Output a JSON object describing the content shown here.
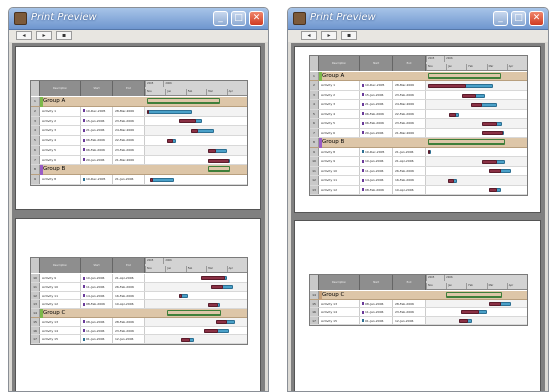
{
  "windows": [
    {
      "title": "Print Preview",
      "toolbar": [
        "◂",
        "▸",
        "▪"
      ],
      "controls": [
        "_",
        "□",
        "✕"
      ],
      "pages": [
        {
          "headers": [
            "Description",
            "Start",
            "End"
          ],
          "tl_top": [
            "2005",
            "2006"
          ],
          "tl_bottom": [
            "Nov",
            "Jan",
            "Feb",
            "Mar",
            "Apr"
          ],
          "rows": [
            {
              "type": "group",
              "num": "1",
              "name": "Group A",
              "color": "#7cb84a",
              "group_bar": [
                0.02,
                0.74
              ]
            },
            {
              "type": "task",
              "num": "2",
              "name": "Activity 1",
              "start": "10-Dec-2005",
              "end": "28-Mar-2006",
              "mark": "#6a3a9a",
              "plan": [
                0.02,
                0.46
              ],
              "actual": [
                0.02,
                0.03
              ]
            },
            {
              "type": "task",
              "num": "3",
              "name": "Activity 2",
              "start": "15-Jan-2006",
              "end": "23-Feb-2006",
              "mark": "#6a3a9a",
              "plan": [
                0.33,
                0.56
              ],
              "actual": [
                0.33,
                0.5
              ]
            },
            {
              "type": "task",
              "num": "4",
              "name": "Activity 3",
              "start": "21-Jan-2006",
              "end": "24-Mar-2006",
              "mark": "#6a3a9a",
              "plan": [
                0.45,
                0.68
              ],
              "actual": [
                0.45,
                0.52
              ]
            },
            {
              "type": "task",
              "num": "5",
              "name": "Activity 4",
              "start": "06-Feb-2006",
              "end": "22-Feb-2006",
              "mark": "#6a3a9a",
              "plan": [
                0.22,
                0.3
              ],
              "actual": [
                0.22,
                0.27
              ]
            },
            {
              "type": "task",
              "num": "6",
              "name": "Activity 5",
              "start": "06-Feb-2006",
              "end": "23-Feb-2006",
              "mark": "#6a3a9a",
              "plan": [
                0.62,
                0.8
              ],
              "actual": [
                0.62,
                0.7
              ]
            },
            {
              "type": "task",
              "num": "7",
              "name": "Activity 6",
              "start": "20-Jan-2006",
              "end": "21-Mar-2006",
              "mark": "#6a3a9a",
              "plan": [
                0.62,
                0.83
              ],
              "actual": [
                0.62,
                0.82
              ]
            },
            {
              "type": "group",
              "num": "8",
              "name": "Group B",
              "color": "#9a5cc6",
              "group_bar": [
                0.62,
                0.83
              ]
            },
            {
              "type": "task",
              "num": "9",
              "name": "Activity 8",
              "start": "10-Dec-2005",
              "end": "21-Jan-2006",
              "mark": "#2c6f92",
              "plan": [
                0.05,
                0.28
              ],
              "actual": [
                0.05,
                0.08
              ]
            }
          ]
        },
        {
          "headers": [
            "Description",
            "Start",
            "End"
          ],
          "tl_top": [
            "2005",
            "2006"
          ],
          "tl_bottom": [
            "Nov",
            "Jan",
            "Feb",
            "Mar",
            "Apr"
          ],
          "rows": [
            {
              "type": "task",
              "num": "10",
              "name": "Activity 9",
              "start": "10-Jan-2006",
              "end": "21-Apr-2006",
              "mark": "#6a3a9a",
              "plan": [
                0.55,
                0.8
              ],
              "actual": [
                0.55,
                0.78
              ]
            },
            {
              "type": "task",
              "num": "11",
              "name": "Activity 10",
              "start": "11-Jan-2006",
              "end": "26-Feb-2006",
              "mark": "#6a3a9a",
              "plan": [
                0.65,
                0.86
              ],
              "actual": [
                0.65,
                0.76
              ]
            },
            {
              "type": "task",
              "num": "12",
              "name": "Activity 11",
              "start": "14-Jan-2006",
              "end": "16-Feb-2006",
              "mark": "#6a3a9a",
              "plan": [
                0.33,
                0.42
              ],
              "actual": [
                0.33,
                0.36
              ]
            },
            {
              "type": "task",
              "num": "13",
              "name": "Activity 12",
              "start": "08-Feb-2006",
              "end": "10-Apr-2006",
              "mark": "#6a3a9a",
              "plan": [
                0.62,
                0.74
              ],
              "actual": [
                0.62,
                0.72
              ]
            },
            {
              "type": "group",
              "num": "14",
              "name": "Group C",
              "color": "#7cb84a",
              "group_bar": [
                0.22,
                0.75
              ]
            },
            {
              "type": "task",
              "num": "15",
              "name": "Activity 13",
              "start": "08-Jan-2006",
              "end": "28-Feb-2006",
              "mark": "#6a3a9a",
              "plan": [
                0.7,
                0.88
              ],
              "actual": [
                0.7,
                0.8
              ]
            },
            {
              "type": "task",
              "num": "16",
              "name": "Activity 14",
              "start": "11-Jan-2006",
              "end": "23-Feb-2006",
              "mark": "#6a3a9a",
              "plan": [
                0.58,
                0.82
              ],
              "actual": [
                0.58,
                0.72
              ]
            },
            {
              "type": "task",
              "num": "17",
              "name": "Activity 15",
              "start": "01-Jan-2006",
              "end": "12-Jan-2006",
              "mark": "#2c6f92",
              "plan": [
                0.35,
                0.48
              ],
              "actual": [
                0.35,
                0.44
              ]
            }
          ]
        }
      ]
    },
    {
      "title": "Print Preview",
      "toolbar": [
        "◂",
        "▸",
        "▪"
      ],
      "controls": [
        "_",
        "□",
        "✕"
      ],
      "pages": [
        {
          "headers": [
            "Description",
            "Start",
            "End"
          ],
          "tl_top": [
            "2005",
            "2006"
          ],
          "tl_bottom": [
            "Nov",
            "Jan",
            "Feb",
            "Mar",
            "Apr"
          ],
          "rows": [
            {
              "type": "group",
              "num": "1",
              "name": "Group A",
              "color": "#7cb84a",
              "group_bar": [
                0.02,
                0.74
              ]
            },
            {
              "type": "task",
              "num": "2",
              "name": "Activity 1",
              "start": "10-Dec-2005",
              "end": "28-Mar-2006",
              "mark": "#6a3a9a",
              "plan": [
                0.02,
                0.66
              ],
              "actual": [
                0.02,
                0.4
              ]
            },
            {
              "type": "task",
              "num": "3",
              "name": "Activity 2",
              "start": "15-Jan-2006",
              "end": "23-Feb-2006",
              "mark": "#6a3a9a",
              "plan": [
                0.36,
                0.58
              ],
              "actual": [
                0.36,
                0.5
              ]
            },
            {
              "type": "task",
              "num": "4",
              "name": "Activity 3",
              "start": "21-Jan-2006",
              "end": "24-Mar-2006",
              "mark": "#6a3a9a",
              "plan": [
                0.45,
                0.7
              ],
              "actual": [
                0.45,
                0.55
              ]
            },
            {
              "type": "task",
              "num": "5",
              "name": "Activity 4",
              "start": "06-Feb-2006",
              "end": "22-Feb-2006",
              "mark": "#6a3a9a",
              "plan": [
                0.23,
                0.33
              ],
              "actual": [
                0.23,
                0.3
              ]
            },
            {
              "type": "task",
              "num": "6",
              "name": "Activity 5",
              "start": "06-Feb-2006",
              "end": "23-Feb-2006",
              "mark": "#6a3a9a",
              "plan": [
                0.55,
                0.75
              ],
              "actual": [
                0.55,
                0.7
              ]
            },
            {
              "type": "task",
              "num": "7",
              "name": "Activity 6",
              "start": "20-Jan-2006",
              "end": "21-Mar-2006",
              "mark": "#6a3a9a",
              "plan": [
                0.55,
                0.77
              ],
              "actual": [
                0.55,
                0.76
              ]
            },
            {
              "type": "group",
              "num": "8",
              "name": "Group B",
              "color": "#9a5cc6",
              "group_bar": [
                0.02,
                0.78
              ]
            },
            {
              "type": "task",
              "num": "9",
              "name": "Activity 8",
              "start": "10-Dec-2005",
              "end": "21-Jan-2006",
              "mark": "#2c6f92",
              "plan": [
                0.02,
                0.05
              ],
              "actual": [
                0.02,
                0.04
              ]
            },
            {
              "type": "task",
              "num": "10",
              "name": "Activity 9",
              "start": "10-Jan-2006",
              "end": "21-Apr-2006",
              "mark": "#6a3a9a",
              "plan": [
                0.55,
                0.78
              ],
              "actual": [
                0.55,
                0.7
              ]
            },
            {
              "type": "task",
              "num": "11",
              "name": "Activity 10",
              "start": "11-Jan-2006",
              "end": "26-Feb-2006",
              "mark": "#6a3a9a",
              "plan": [
                0.62,
                0.84
              ],
              "actual": [
                0.62,
                0.74
              ]
            },
            {
              "type": "task",
              "num": "12",
              "name": "Activity 11",
              "start": "14-Jan-2006",
              "end": "16-Feb-2006",
              "mark": "#6a3a9a",
              "plan": [
                0.22,
                0.31
              ],
              "actual": [
                0.22,
                0.28
              ]
            },
            {
              "type": "task",
              "num": "13",
              "name": "Activity 12",
              "start": "08-Feb-2006",
              "end": "10-Apr-2006",
              "mark": "#6a3a9a",
              "plan": [
                0.62,
                0.74
              ],
              "actual": [
                0.62,
                0.7
              ]
            }
          ]
        },
        {
          "headers": [
            "Description",
            "Start",
            "End"
          ],
          "tl_top": [
            "2005",
            "2006"
          ],
          "tl_bottom": [
            "Nov",
            "Jan",
            "Feb",
            "Mar",
            "Apr"
          ],
          "rows": [
            {
              "type": "group",
              "num": "14",
              "name": "Group C",
              "color": "#c6a07a",
              "group_bar": [
                0.2,
                0.75
              ]
            },
            {
              "type": "task",
              "num": "15",
              "name": "Activity 13",
              "start": "08-Jan-2006",
              "end": "28-Feb-2006",
              "mark": "#6a3a9a",
              "plan": [
                0.62,
                0.84
              ],
              "actual": [
                0.62,
                0.74
              ]
            },
            {
              "type": "task",
              "num": "16",
              "name": "Activity 14",
              "start": "11-Jan-2006",
              "end": "23-Feb-2006",
              "mark": "#6a3a9a",
              "plan": [
                0.35,
                0.6
              ],
              "actual": [
                0.35,
                0.52
              ]
            },
            {
              "type": "task",
              "num": "17",
              "name": "Activity 15",
              "start": "01-Jan-2006",
              "end": "12-Jan-2006",
              "mark": "#2c6f92",
              "plan": [
                0.33,
                0.46
              ],
              "actual": [
                0.33,
                0.42
              ]
            }
          ]
        }
      ]
    }
  ]
}
